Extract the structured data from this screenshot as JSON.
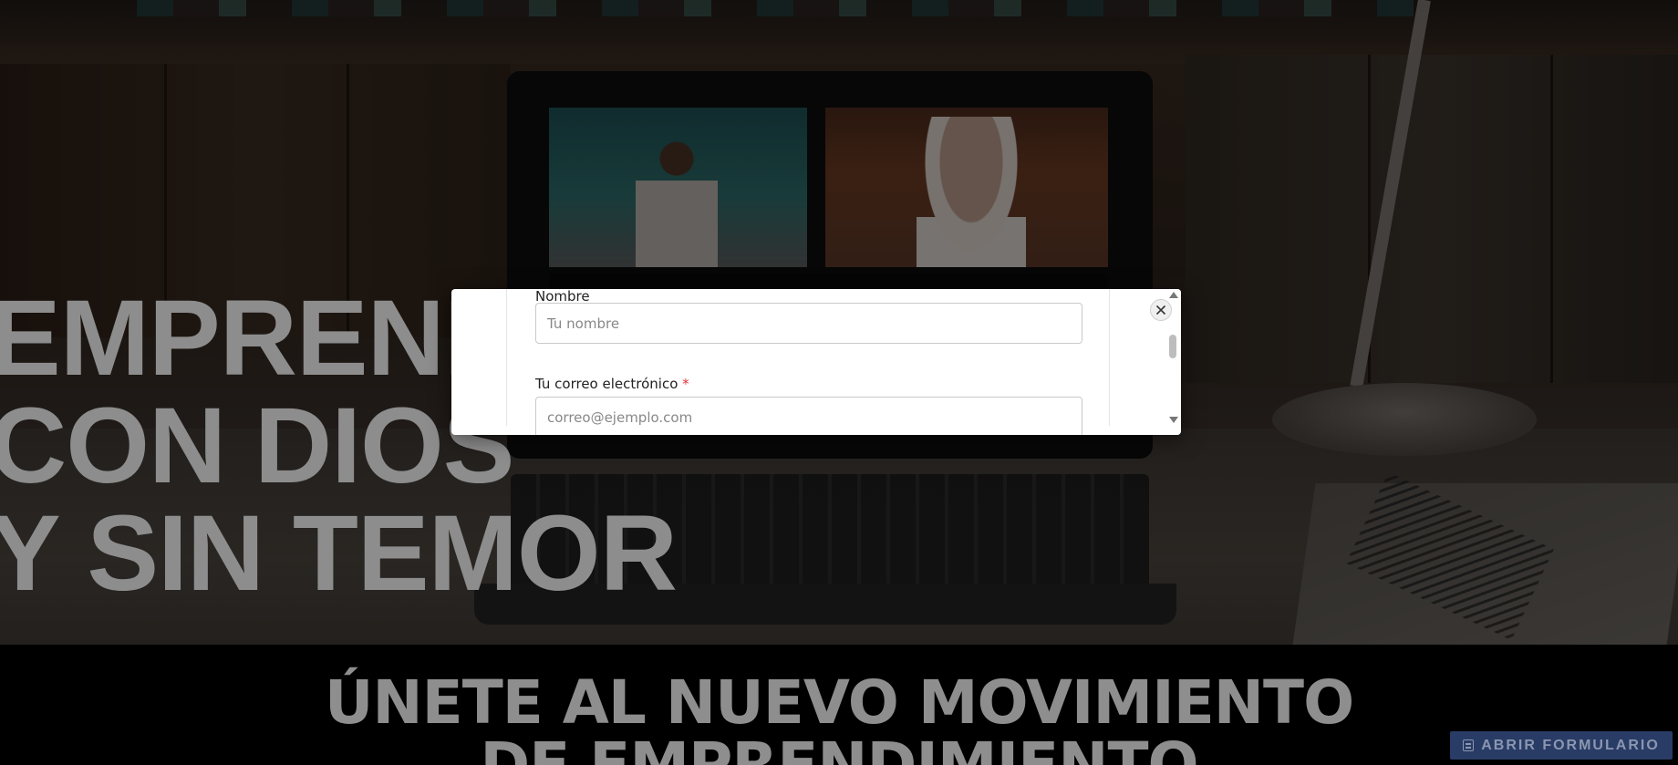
{
  "hero": {
    "headline": "EMPRENDE\nCON DIOS\nY SIN TEMOR"
  },
  "band": {
    "title": "ÚNETE AL NUEVO MOVIMIENTO\nDE EMPRENDIMIENTO"
  },
  "floating_button": {
    "label": "ABRIR FORMULARIO",
    "icon": "form-icon",
    "color": "#293c66"
  },
  "modal": {
    "close_icon": "close-icon",
    "fields": [
      {
        "label": "Nombre",
        "placeholder": "Tu nombre",
        "value": "",
        "required": false
      },
      {
        "label": "Tu correo electrónico",
        "placeholder": "correo@ejemplo.com",
        "value": "",
        "required": true,
        "required_mark": "*"
      }
    ]
  }
}
